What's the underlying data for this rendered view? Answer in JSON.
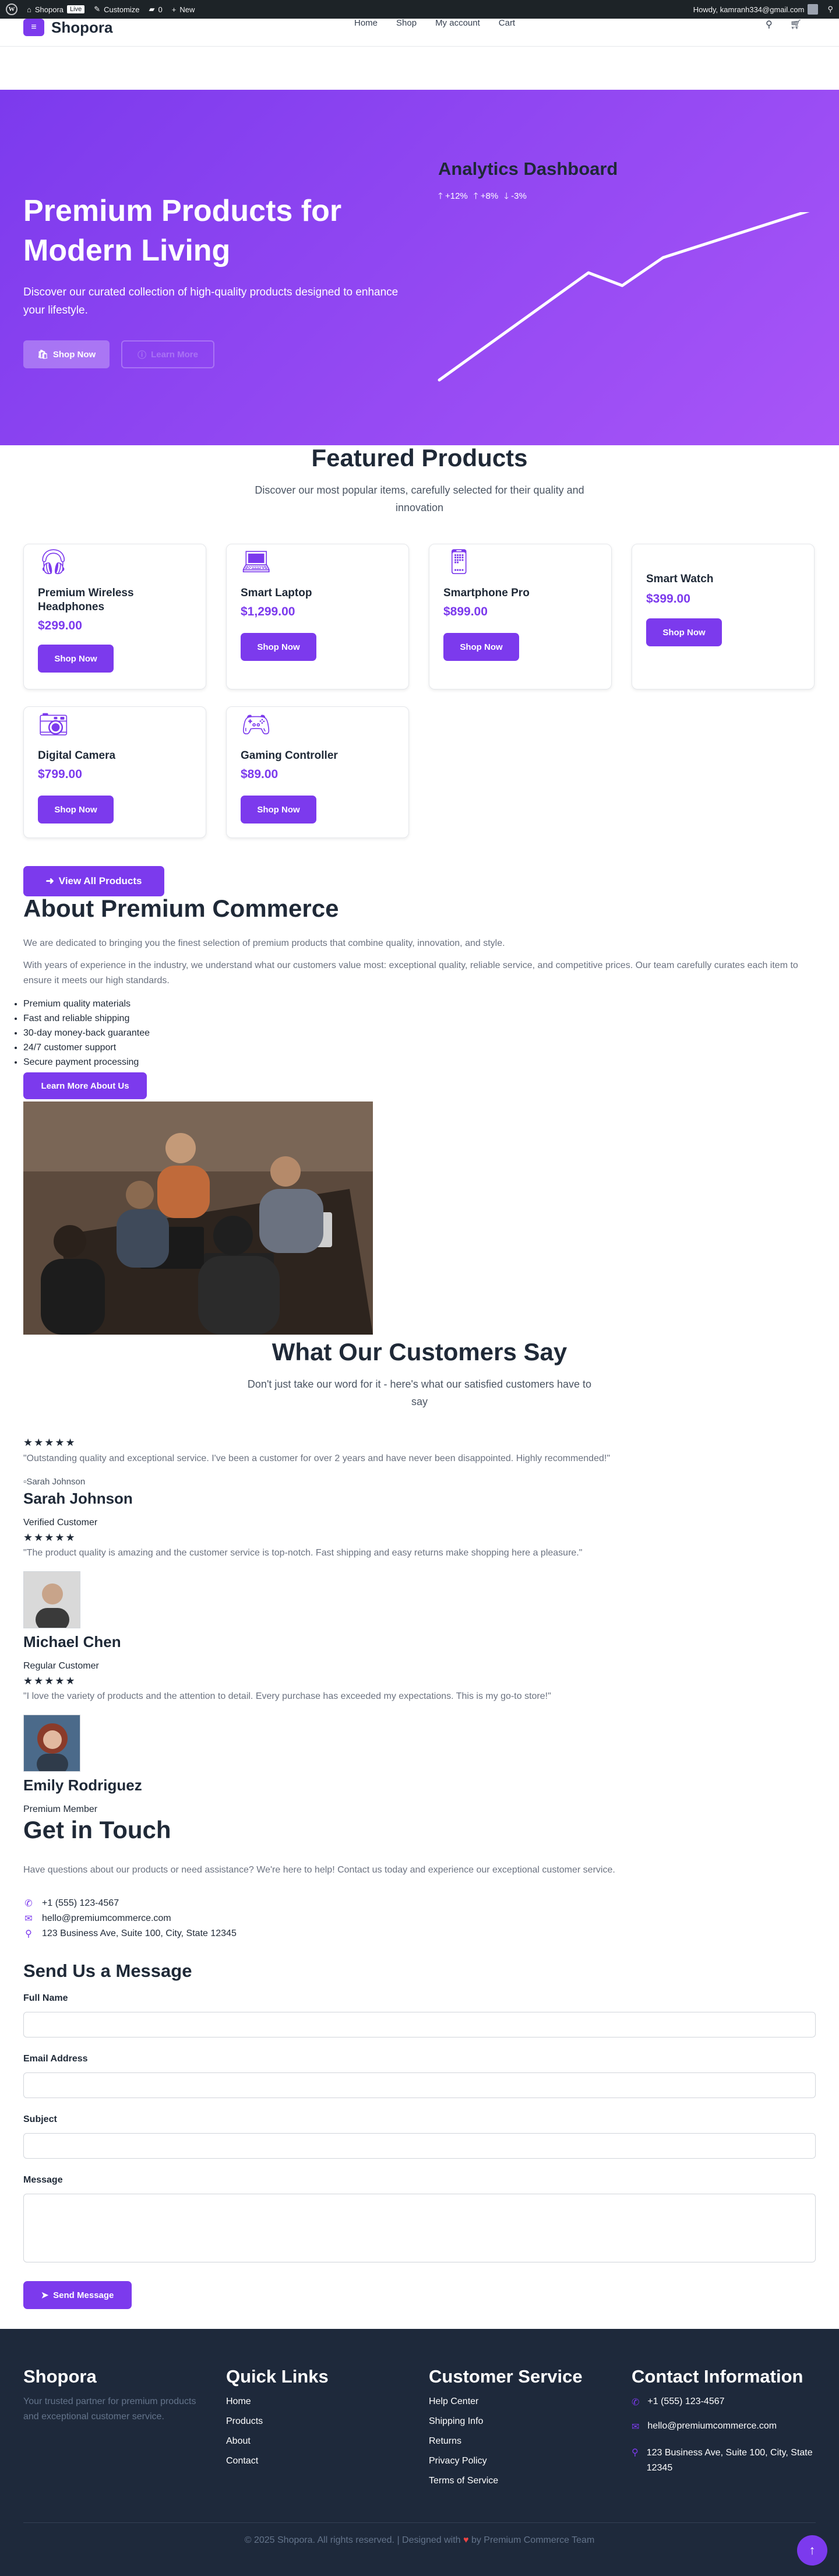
{
  "adminbar": {
    "site": "Shopora",
    "live": "Live",
    "customize": "Customize",
    "comments": "0",
    "new": "New",
    "howdy": "Howdy, kamranh334@gmail.com"
  },
  "header": {
    "logo": "Shopora",
    "nav": [
      "Home",
      "Shop",
      "My account",
      "Cart"
    ]
  },
  "hero": {
    "title": "Premium Products for Modern Living",
    "subtitle": "Discover our curated collection of high-quality products designed to enhance your lifestyle.",
    "cta_primary": "Shop Now",
    "cta_secondary": "Learn More",
    "dashboard_title": "Analytics Dashboard",
    "stats": [
      "+12%",
      "+8%",
      "-3%"
    ]
  },
  "featured": {
    "title": "Featured Products",
    "subtitle": "Discover our most popular items, carefully selected for their quality and innovation",
    "products": [
      {
        "name": "Premium Wireless Headphones",
        "price": "$299.00",
        "button": "Shop Now",
        "icon": "headphones-icon"
      },
      {
        "name": "Smart Laptop",
        "price": "$1,299.00",
        "button": "Shop Now",
        "icon": "laptop-icon"
      },
      {
        "name": "Smartphone Pro",
        "price": "$899.00",
        "button": "Shop Now",
        "icon": "smartphone-icon"
      },
      {
        "name": "Smart Watch",
        "price": "$399.00",
        "button": "Shop Now",
        "icon": "watch-icon"
      },
      {
        "name": "Digital Camera",
        "price": "$799.00",
        "button": "Shop Now",
        "icon": "camera-icon"
      },
      {
        "name": "Gaming Controller",
        "price": "$89.00",
        "button": "Shop Now",
        "icon": "gamepad-icon"
      }
    ],
    "view_all": "View All Products"
  },
  "about": {
    "title": "About Premium Commerce",
    "p1": "We are dedicated to bringing you the finest selection of premium products that combine quality, innovation, and style.",
    "p2": "With years of experience in the industry, we understand what our customers value most: exceptional quality, reliable service, and competitive prices. Our team carefully curates each item to ensure it meets our high standards.",
    "list": [
      "Premium quality materials",
      "Fast and reliable shipping",
      "30-day money-back guarantee",
      "24/7 customer support",
      "Secure payment processing"
    ],
    "button": "Learn More About Us"
  },
  "testimonials": {
    "title": "What Our Customers Say",
    "subtitle": "Don't just take our word for it - here's what our satisfied customers have to say",
    "stars": "★★★★★",
    "items": [
      {
        "quote": "\"Outstanding quality and exceptional service. I've been a customer for over 2 years and have never been disappointed. Highly recommended!\"",
        "alt": "Sarah Johnson",
        "name": "Sarah Johnson",
        "role": "Verified Customer"
      },
      {
        "quote": "\"The product quality is amazing and the customer service is top-notch. Fast shipping and easy returns make shopping here a pleasure.\"",
        "name": "Michael Chen",
        "role": "Regular Customer"
      },
      {
        "quote": "\"I love the variety of products and the attention to detail. Every purchase has exceeded my expectations. This is my go-to store!\"",
        "name": "Emily Rodriguez",
        "role": "Premium Member"
      }
    ]
  },
  "contact": {
    "title": "Get in Touch",
    "intro": "Have questions about our products or need assistance? We're here to help! Contact us today and experience our exceptional customer service.",
    "phone": "+1 (555) 123-4567",
    "email": "hello@premiumcommerce.com",
    "address": "123 Business Ave, Suite 100, City, State 12345",
    "form_title": "Send Us a Message",
    "labels": {
      "name": "Full Name",
      "email": "Email Address",
      "subject": "Subject",
      "message": "Message"
    },
    "submit": "Send Message"
  },
  "footer": {
    "brand": "Shopora",
    "tagline": "Your trusted partner for premium products and exceptional customer service.",
    "quick_title": "Quick Links",
    "quick_links": [
      "Home",
      "Products",
      "About",
      "Contact"
    ],
    "service_title": "Customer Service",
    "service_links": [
      "Help Center",
      "Shipping Info",
      "Returns",
      "Privacy Policy",
      "Terms of Service"
    ],
    "contact_title": "Contact Information",
    "phone": "+1 (555) 123-4567",
    "email": "hello@premiumcommerce.com",
    "address": "123 Business Ave, Suite 100, City, State 12345",
    "copyright_a": "© 2025 Shopora. All rights reserved. | Designed with",
    "copyright_b": "by Premium Commerce Team"
  },
  "colors": {
    "accent": "#7c3aed",
    "hero_gradient_end": "#a855f7",
    "footer_bg": "#1e293b"
  }
}
